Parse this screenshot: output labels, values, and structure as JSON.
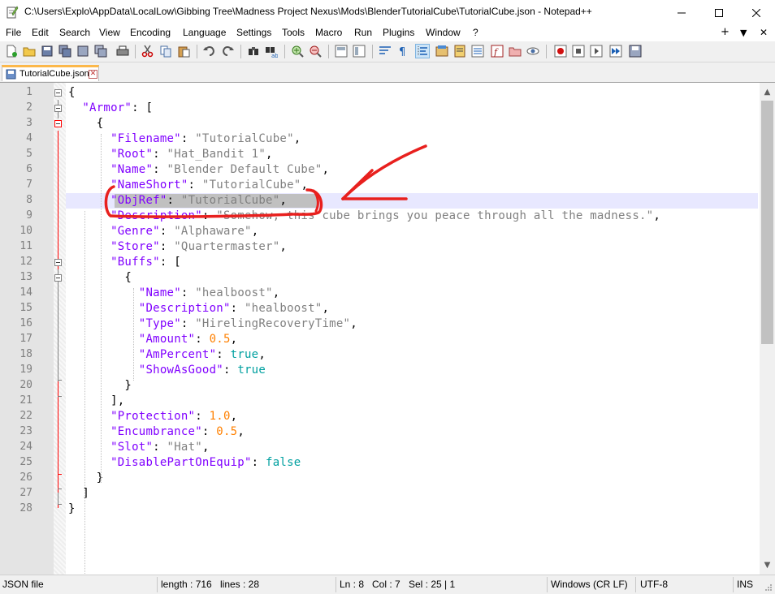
{
  "window": {
    "title": "C:\\Users\\Explo\\AppData\\LocalLow\\Gibbing Tree\\Madness Project Nexus\\Mods\\BlenderTutorialCube\\TutorialCube.json - Notepad++"
  },
  "menu": [
    "File",
    "Edit",
    "Search",
    "View",
    "Encoding",
    "Language",
    "Settings",
    "Tools",
    "Macro",
    "Run",
    "Plugins",
    "Window",
    "?"
  ],
  "menu_right": {
    "plus": "+",
    "down": "▼",
    "close": "✕"
  },
  "tab": {
    "label": "TutorialCube.json"
  },
  "editor": {
    "current_line": 8,
    "lines": [
      {
        "n": "1",
        "text": "{"
      },
      {
        "n": "2",
        "text": "  \"Armor\": ["
      },
      {
        "n": "3",
        "text": "    {"
      },
      {
        "n": "4",
        "text": "      \"Filename\": \"TutorialCube\","
      },
      {
        "n": "5",
        "text": "      \"Root\": \"Hat_Bandit 1\","
      },
      {
        "n": "6",
        "text": "      \"Name\": \"Blender Default Cube\","
      },
      {
        "n": "7",
        "text": "      \"NameShort\": \"TutorialCube\","
      },
      {
        "n": "8",
        "text": "      \"ObjRef\": \"TutorialCube\","
      },
      {
        "n": "9",
        "text": "      \"Description\": \"Somehow, this cube brings you peace through all the madness.\","
      },
      {
        "n": "10",
        "text": "      \"Genre\": \"Alphaware\","
      },
      {
        "n": "11",
        "text": "      \"Store\": \"Quartermaster\","
      },
      {
        "n": "12",
        "text": "      \"Buffs\": ["
      },
      {
        "n": "13",
        "text": "        {"
      },
      {
        "n": "14",
        "text": "          \"Name\": \"healboost\","
      },
      {
        "n": "15",
        "text": "          \"Description\": \"healboost\","
      },
      {
        "n": "16",
        "text": "          \"Type\": \"HirelingRecoveryTime\","
      },
      {
        "n": "17",
        "text": "          \"Amount\": 0.5,"
      },
      {
        "n": "18",
        "text": "          \"AmPercent\": true,"
      },
      {
        "n": "19",
        "text": "          \"ShowAsGood\": true"
      },
      {
        "n": "20",
        "text": "        }"
      },
      {
        "n": "21",
        "text": "      ],"
      },
      {
        "n": "22",
        "text": "      \"Protection\": 1.0,"
      },
      {
        "n": "23",
        "text": "      \"Encumbrance\": 0.5,"
      },
      {
        "n": "24",
        "text": "      \"Slot\": \"Hat\","
      },
      {
        "n": "25",
        "text": "      \"DisablePartOnEquip\": false"
      },
      {
        "n": "26",
        "text": "    }"
      },
      {
        "n": "27",
        "text": "  ]"
      },
      {
        "n": "28",
        "text": "}"
      }
    ]
  },
  "status": {
    "filetype": "JSON file",
    "length": "length : 716",
    "lines": "lines : 28",
    "ln": "Ln : 8",
    "col": "Col : 7",
    "sel": "Sel : 25 | 1",
    "eol": "Windows (CR LF)",
    "encoding": "UTF-8",
    "mode": "INS"
  },
  "colors": {
    "key": "#8000ff",
    "string": "#808080",
    "number": "#ff8000",
    "bool": "#00a0a0",
    "annotation": "#e8201e",
    "tab_accent": "#fcb84a"
  }
}
